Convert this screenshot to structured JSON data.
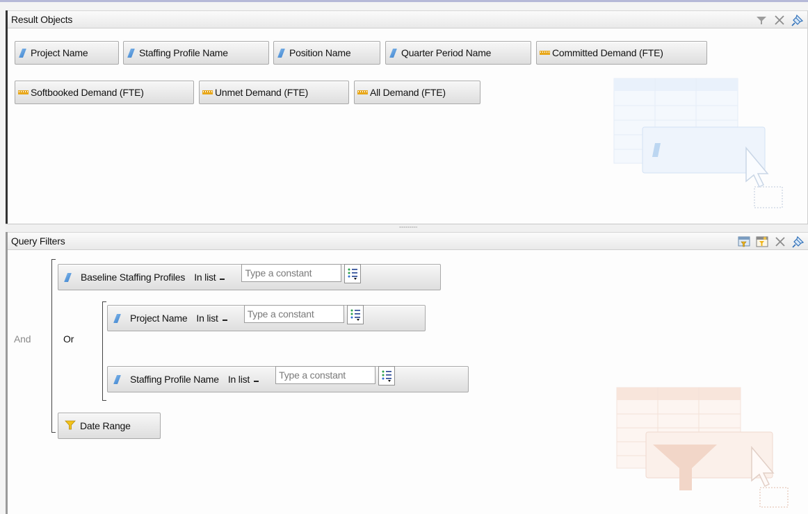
{
  "result_panel": {
    "title": "Result Objects",
    "objects": [
      {
        "label": "Project Name",
        "kind": "dimension"
      },
      {
        "label": "Staffing Profile Name",
        "kind": "dimension"
      },
      {
        "label": "Position Name",
        "kind": "dimension"
      },
      {
        "label": "Quarter Period Name",
        "kind": "dimension"
      },
      {
        "label": "Committed Demand (FTE)",
        "kind": "measure"
      },
      {
        "label": "Softbooked Demand (FTE)",
        "kind": "measure"
      },
      {
        "label": "Unmet Demand (FTE)",
        "kind": "measure"
      },
      {
        "label": "All Demand (FTE)",
        "kind": "measure"
      }
    ],
    "tools": [
      "filter-icon",
      "close-icon",
      "pin-icon"
    ]
  },
  "filter_panel": {
    "title": "Query Filters",
    "tools": [
      "save-filter-icon",
      "predefined-filter-icon",
      "close-icon",
      "pin-icon"
    ],
    "root_operator": "And",
    "nested_operator": "Or",
    "filters": [
      {
        "object": "Baseline Staffing Profiles",
        "operator": "In list",
        "placeholder": "Type a constant"
      },
      {
        "object": "Project Name",
        "operator": "In list",
        "placeholder": "Type a constant"
      },
      {
        "object": "Staffing Profile Name",
        "operator": "In list",
        "placeholder": "Type a constant"
      }
    ],
    "predefined_filter": {
      "label": "Date Range"
    }
  },
  "colors": {
    "dimension": "#4a8fd6",
    "measure": "#e8a71a",
    "filter": "#f2c21a",
    "panel_header": "#ececec"
  }
}
